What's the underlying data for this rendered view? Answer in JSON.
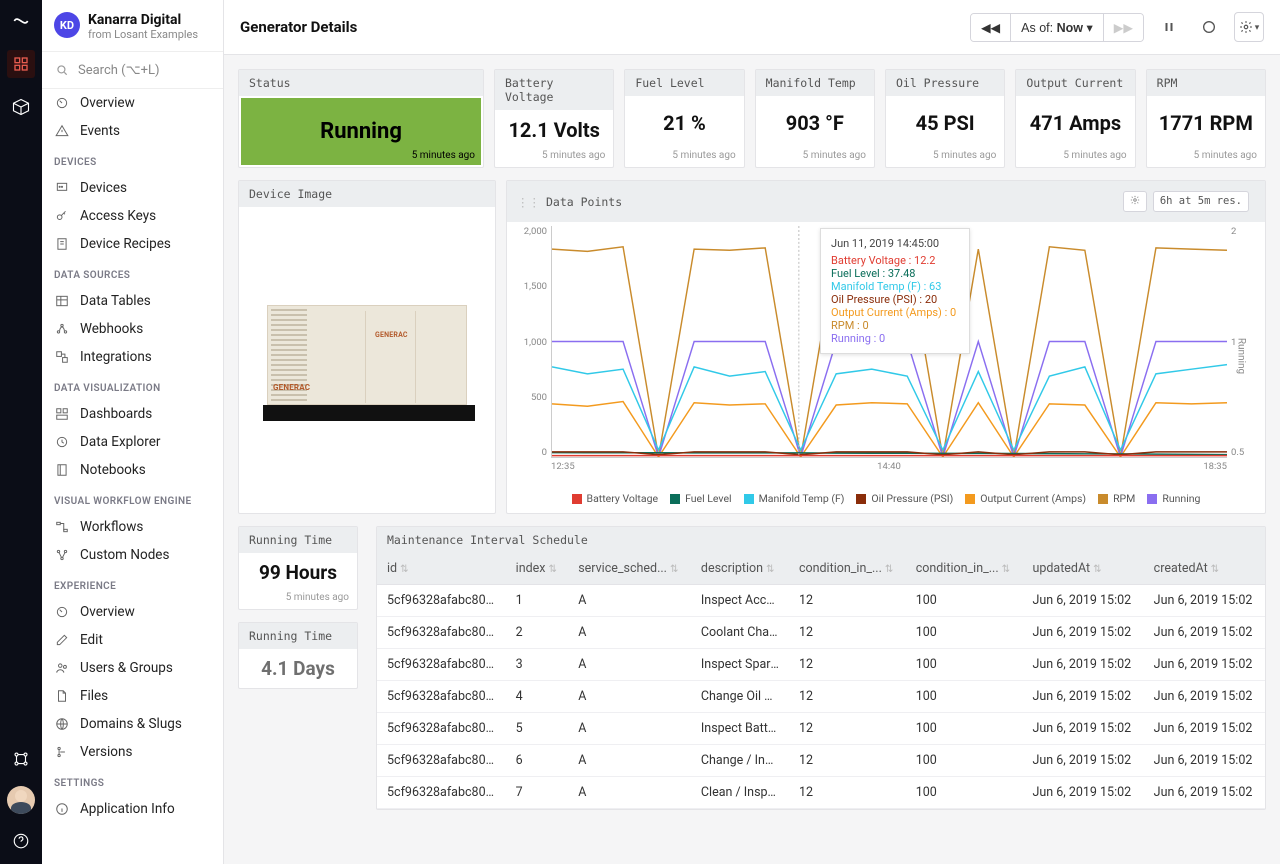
{
  "org": {
    "badge": "KD",
    "name": "Kanarra Digital",
    "sub": "from Losant Examples"
  },
  "search": {
    "placeholder": "Search (⌥+L)"
  },
  "sidebar": {
    "groups": [
      {
        "label": "",
        "items": [
          {
            "icon": "gauge-icon",
            "label": "Overview"
          },
          {
            "icon": "warning-icon",
            "label": "Events"
          }
        ]
      },
      {
        "label": "DEVICES",
        "items": [
          {
            "icon": "device-icon",
            "label": "Devices"
          },
          {
            "icon": "key-icon",
            "label": "Access Keys"
          },
          {
            "icon": "recipe-icon",
            "label": "Device Recipes"
          }
        ]
      },
      {
        "label": "DATA SOURCES",
        "items": [
          {
            "icon": "table-icon",
            "label": "Data Tables"
          },
          {
            "icon": "webhook-icon",
            "label": "Webhooks"
          },
          {
            "icon": "integrations-icon",
            "label": "Integrations"
          }
        ]
      },
      {
        "label": "DATA VISUALIZATION",
        "items": [
          {
            "icon": "dashboard-icon",
            "label": "Dashboards"
          },
          {
            "icon": "explorer-icon",
            "label": "Data Explorer"
          },
          {
            "icon": "notebook-icon",
            "label": "Notebooks"
          }
        ]
      },
      {
        "label": "VISUAL WORKFLOW ENGINE",
        "items": [
          {
            "icon": "workflow-icon",
            "label": "Workflows"
          },
          {
            "icon": "nodes-icon",
            "label": "Custom Nodes"
          }
        ]
      },
      {
        "label": "EXPERIENCE",
        "items": [
          {
            "icon": "gauge-icon",
            "label": "Overview"
          },
          {
            "icon": "edit-icon",
            "label": "Edit"
          },
          {
            "icon": "users-icon",
            "label": "Users & Groups"
          },
          {
            "icon": "files-icon",
            "label": "Files"
          },
          {
            "icon": "globe-icon",
            "label": "Domains & Slugs"
          },
          {
            "icon": "versions-icon",
            "label": "Versions"
          }
        ]
      },
      {
        "label": "SETTINGS",
        "items": [
          {
            "icon": "info-icon",
            "label": "Application Info"
          }
        ]
      }
    ]
  },
  "topbar": {
    "title": "Generator Details",
    "asof_prefix": "As of: ",
    "asof_value": "Now"
  },
  "kpis": [
    {
      "title": "Status",
      "value": "Running",
      "foot": "5 minutes ago",
      "kind": "status"
    },
    {
      "title": "Battery Voltage",
      "value": "12.1 Volts",
      "foot": "5 minutes ago"
    },
    {
      "title": "Fuel Level",
      "value": "21 %",
      "foot": "5 minutes ago"
    },
    {
      "title": "Manifold Temp",
      "value": "903 °F",
      "foot": "5 minutes ago"
    },
    {
      "title": "Oil Pressure",
      "value": "45 PSI",
      "foot": "5 minutes ago"
    },
    {
      "title": "Output Current",
      "value": "471 Amps",
      "foot": "5 minutes ago"
    },
    {
      "title": "RPM",
      "value": "1771 RPM",
      "foot": "5 minutes ago"
    }
  ],
  "device_image": {
    "title": "Device Image",
    "brand": "GENERAC"
  },
  "chart": {
    "title": "Data Points",
    "res_label": "6h at 5m res.",
    "y_left": [
      "2,000",
      "1,500",
      "1,000",
      "500",
      "0"
    ],
    "y_right": [
      "2",
      "1",
      "0.5"
    ],
    "y_right_label": "Running",
    "x": [
      "12:35",
      "14:40",
      "18:35"
    ],
    "legend": [
      {
        "name": "Battery Voltage",
        "color": "#e03c31"
      },
      {
        "name": "Fuel Level",
        "color": "#0b6e5a"
      },
      {
        "name": "Manifold Temp (F)",
        "color": "#31c9e8"
      },
      {
        "name": "Oil Pressure (PSI)",
        "color": "#8a2d0a"
      },
      {
        "name": "Output Current (Amps)",
        "color": "#f39a1e"
      },
      {
        "name": "RPM",
        "color": "#c98b2c"
      },
      {
        "name": "Running",
        "color": "#8a6ef0"
      }
    ],
    "tooltip": {
      "time": "Jun 11, 2019 14:45:00",
      "rows": [
        {
          "label": "Battery Voltage",
          "val": "12.2",
          "color": "#e03c31"
        },
        {
          "label": "Fuel Level",
          "val": "37.48",
          "color": "#0b6e5a"
        },
        {
          "label": "Manifold Temp (F)",
          "val": "63",
          "color": "#31c9e8"
        },
        {
          "label": "Oil Pressure (PSI)",
          "val": "20",
          "color": "#8a2d0a"
        },
        {
          "label": "Output Current (Amps)",
          "val": "0",
          "color": "#f39a1e"
        },
        {
          "label": "RPM",
          "val": "0",
          "color": "#c98b2c"
        },
        {
          "label": "Running",
          "val": "0",
          "color": "#8a6ef0"
        }
      ]
    }
  },
  "running_time": [
    {
      "title": "Running Time",
      "value": "99 Hours",
      "foot": "5 minutes ago"
    },
    {
      "title": "Running Time",
      "value": "4.1 Days",
      "foot": ""
    }
  ],
  "table": {
    "title": "Maintenance Interval Schedule",
    "columns": [
      "id",
      "index",
      "service_sched...",
      "description",
      "condition_in_...",
      "condition_in_...",
      "updatedAt",
      "createdAt"
    ],
    "rows": [
      [
        "5cf96328afabc800087...",
        "1",
        "A",
        "Inspect Acces...",
        "12",
        "100",
        "Jun 6, 2019 15:02",
        "Jun 6, 2019 15:02"
      ],
      [
        "5cf96328afabc800087...",
        "2",
        "A",
        "Coolant Chan...",
        "12",
        "100",
        "Jun 6, 2019 15:02",
        "Jun 6, 2019 15:02"
      ],
      [
        "5cf96328afabc800087...",
        "3",
        "A",
        "Inspect Spark ...",
        "12",
        "100",
        "Jun 6, 2019 15:02",
        "Jun 6, 2019 15:02"
      ],
      [
        "5cf96328afabc800087...",
        "4",
        "A",
        "Change Oil & ...",
        "12",
        "100",
        "Jun 6, 2019 15:02",
        "Jun 6, 2019 15:02"
      ],
      [
        "5cf96328afabc800087...",
        "5",
        "A",
        "Inspect Batter...",
        "12",
        "100",
        "Jun 6, 2019 15:02",
        "Jun 6, 2019 15:02"
      ],
      [
        "5cf96328afabc800087...",
        "6",
        "A",
        "Change / Insp...",
        "12",
        "100",
        "Jun 6, 2019 15:02",
        "Jun 6, 2019 15:02"
      ],
      [
        "5cf96328afabc800087...",
        "7",
        "A",
        "Clean / Inspe...",
        "12",
        "100",
        "Jun 6, 2019 15:02",
        "Jun 6, 2019 15:02"
      ]
    ]
  },
  "chart_data": {
    "type": "line",
    "x_range": [
      "12:35",
      "18:35"
    ],
    "y_left_range": [
      0,
      2000
    ],
    "y_right_range": [
      0,
      2
    ],
    "series": [
      {
        "name": "RPM",
        "color": "#c98b2c",
        "approx_values": [
          1800,
          1780,
          1820,
          0,
          1800,
          1790,
          1810,
          0,
          1790,
          1810,
          1800,
          0,
          1800,
          0,
          1820,
          1790,
          0,
          1810,
          1800,
          1790
        ]
      },
      {
        "name": "Running",
        "color": "#8a6ef0",
        "axis": "right",
        "approx_values": [
          1,
          1,
          1,
          0,
          1,
          1,
          1,
          0,
          1,
          1,
          1,
          0,
          1,
          0,
          1,
          1,
          0,
          1,
          1,
          1
        ]
      },
      {
        "name": "Manifold Temp (F)",
        "color": "#31c9e8",
        "approx_values": [
          780,
          720,
          760,
          60,
          780,
          700,
          740,
          60,
          720,
          760,
          700,
          60,
          740,
          60,
          700,
          780,
          60,
          720,
          760,
          800
        ]
      },
      {
        "name": "Output Current (Amps)",
        "color": "#f39a1e",
        "approx_values": [
          460,
          440,
          480,
          0,
          470,
          450,
          460,
          0,
          450,
          470,
          460,
          0,
          470,
          0,
          460,
          450,
          0,
          470,
          460,
          470
        ]
      },
      {
        "name": "Fuel Level",
        "color": "#0b6e5a",
        "approx_values": [
          38,
          37,
          37,
          37,
          36,
          36,
          35,
          35,
          34,
          33,
          33,
          32,
          31,
          30,
          29,
          28,
          27,
          25,
          23,
          21
        ]
      },
      {
        "name": "Oil Pressure (PSI)",
        "color": "#8a2d0a",
        "approx_values": [
          45,
          44,
          45,
          20,
          45,
          44,
          45,
          20,
          45,
          44,
          45,
          20,
          45,
          20,
          45,
          44,
          20,
          45,
          44,
          45
        ]
      },
      {
        "name": "Battery Voltage",
        "color": "#e03c31",
        "approx_values": [
          12,
          12,
          12,
          12,
          12,
          12,
          12,
          12,
          12,
          12,
          12,
          12,
          12,
          12,
          12,
          12,
          12,
          12,
          12,
          12
        ]
      }
    ]
  }
}
